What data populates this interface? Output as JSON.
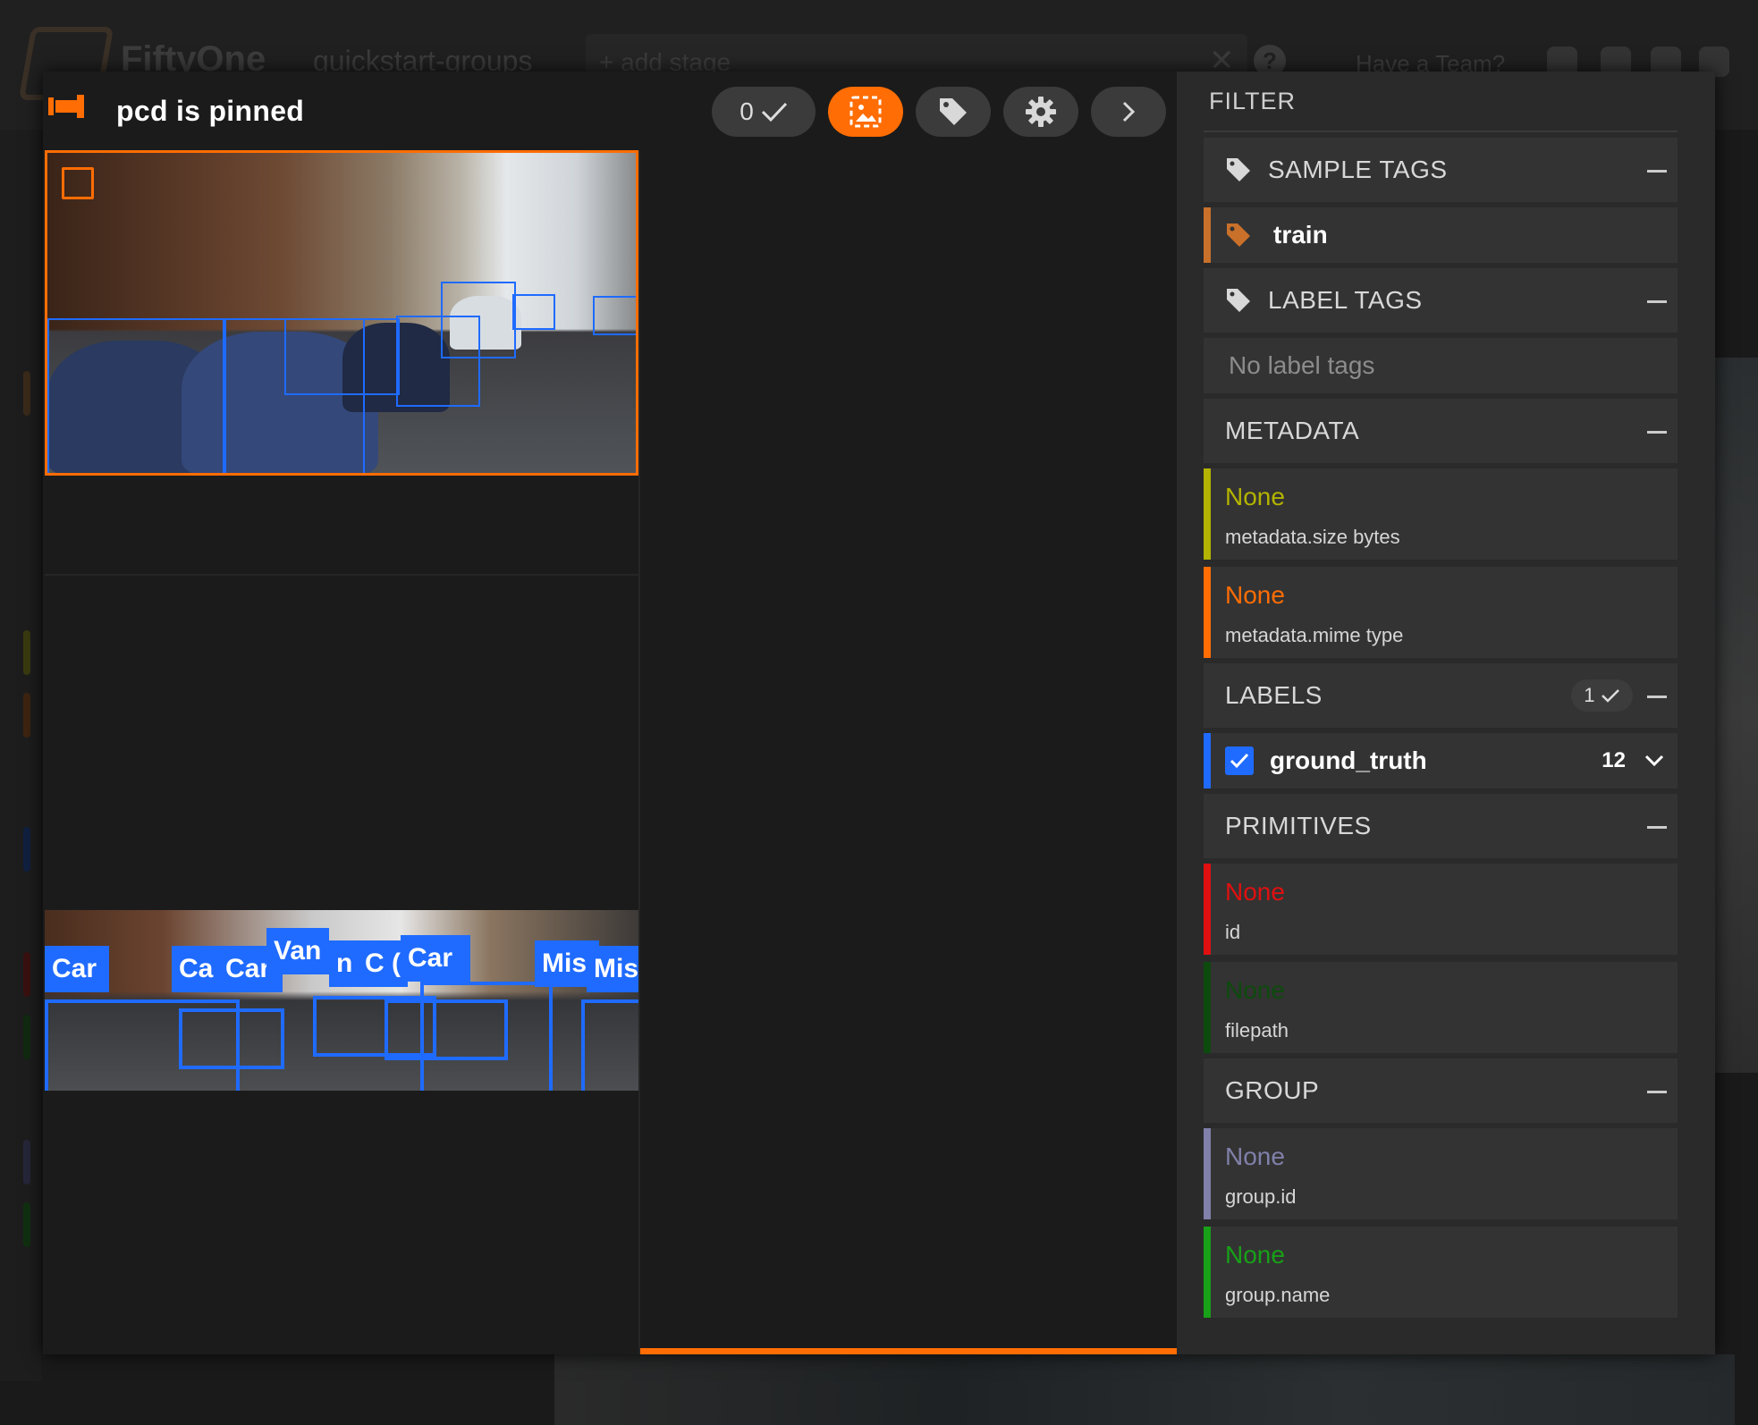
{
  "background": {
    "brand": "FiftyOne",
    "dataset": "quickstart-groups",
    "add_stage": "+ add stage",
    "team": "Have a Team?"
  },
  "modal": {
    "pinned_text": "pcd is pinned",
    "selected_count": "0",
    "toolbar": {
      "count_icon": "check-icon",
      "image_icon": "image-icon",
      "tag_icon": "tag-icon",
      "settings_icon": "gear-icon",
      "next_icon": "chevron-right-icon"
    },
    "accent_color": "#ff6d04",
    "label_color": "#1f6bff",
    "detection_labels": [
      "Car",
      "Ca",
      "Car",
      "Van",
      "n",
      "C",
      "(",
      "Car",
      "Mis",
      "Misc"
    ]
  },
  "sidebar": {
    "title": "FILTER",
    "sample_tags": {
      "header": "SAMPLE TAGS",
      "items": [
        {
          "label": "train",
          "color": "#c9702a"
        }
      ]
    },
    "label_tags": {
      "header": "LABEL TAGS",
      "empty_text": "No label tags"
    },
    "metadata": {
      "header": "METADATA",
      "fields": [
        {
          "value": "None",
          "path": "metadata.size bytes",
          "color": "#b3b300"
        },
        {
          "value": "None",
          "path": "metadata.mime type",
          "color": "#ff6d04"
        }
      ]
    },
    "labels": {
      "header": "LABELS",
      "selected_count": "1",
      "fields": [
        {
          "label": "ground_truth",
          "count": "12",
          "color": "#1f6bff"
        }
      ]
    },
    "primitives": {
      "header": "PRIMITIVES",
      "fields": [
        {
          "value": "None",
          "path": "id",
          "color": "#e01010"
        },
        {
          "value": "None",
          "path": "filepath",
          "color": "#0d4a0d"
        }
      ]
    },
    "group": {
      "header": "GROUP",
      "fields": [
        {
          "value": "None",
          "path": "group.id",
          "color": "#8080aa"
        },
        {
          "value": "None",
          "path": "group.name",
          "color": "#18a018"
        }
      ]
    }
  }
}
